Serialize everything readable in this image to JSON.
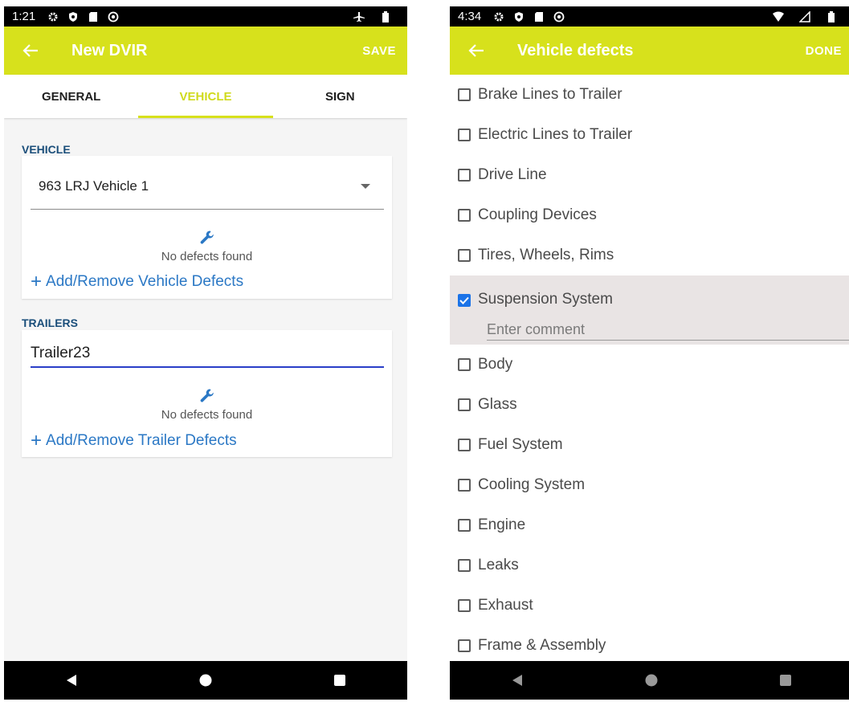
{
  "left_screen": {
    "status_bar": {
      "time": "1:21"
    },
    "app_bar": {
      "title": "New DVIR",
      "action": "SAVE"
    },
    "tabs": [
      {
        "label": "GENERAL",
        "active": false
      },
      {
        "label": "VEHICLE",
        "active": true
      },
      {
        "label": "SIGN",
        "active": false
      }
    ],
    "vehicle_section": {
      "label": "VEHICLE",
      "selected_vehicle": "963 LRJ Vehicle 1",
      "defects_status": "No defects found",
      "add_link": "Add/Remove Vehicle Defects"
    },
    "trailers_section": {
      "label": "TRAILERS",
      "trailer_value": "Trailer23",
      "defects_status": "No defects found",
      "add_link": "Add/Remove Trailer Defects"
    }
  },
  "right_screen": {
    "status_bar": {
      "time": "4:34"
    },
    "app_bar": {
      "title": "Vehicle defects",
      "action": "DONE"
    },
    "defects": [
      {
        "label": "Brake Lines to Trailer",
        "checked": false
      },
      {
        "label": "Electric Lines to Trailer",
        "checked": false
      },
      {
        "label": "Drive Line",
        "checked": false
      },
      {
        "label": "Coupling Devices",
        "checked": false
      },
      {
        "label": "Tires, Wheels, Rims",
        "checked": false
      },
      {
        "label": "Suspension System",
        "checked": true
      },
      {
        "label": "Body",
        "checked": false
      },
      {
        "label": "Glass",
        "checked": false
      },
      {
        "label": "Fuel System",
        "checked": false
      },
      {
        "label": "Cooling System",
        "checked": false
      },
      {
        "label": "Engine",
        "checked": false
      },
      {
        "label": "Leaks",
        "checked": false
      },
      {
        "label": "Exhaust",
        "checked": false
      },
      {
        "label": "Frame & Assembly",
        "checked": false
      }
    ],
    "comment_placeholder": "Enter comment"
  },
  "colors": {
    "app_bar": "#d7e11c",
    "tab_active": "#d0da1c",
    "section_label": "#1a4e7a",
    "link": "#2b78c5",
    "checkbox_checked": "#1b73e8"
  },
  "icons": {
    "back": "arrow-left-icon",
    "wrench": "wrench-icon",
    "dropdown": "dropdown-arrow-icon",
    "nav": [
      "back-triangle-icon",
      "home-circle-icon",
      "recents-square-icon"
    ]
  }
}
